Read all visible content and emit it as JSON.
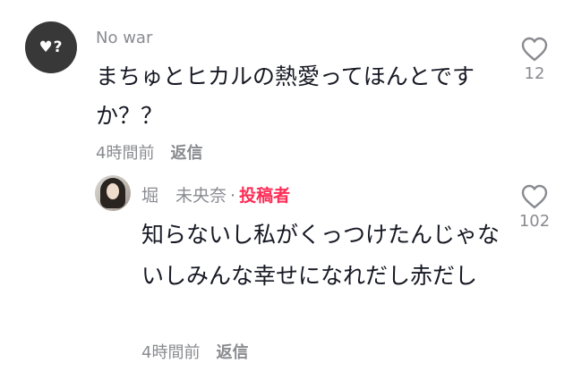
{
  "comment": {
    "username": "No war",
    "avatar_text": "♥?",
    "text": "まちゅとヒカルの熱愛ってほんとですか？？",
    "time": "4時間前",
    "reply_label": "返信",
    "like_count": "12",
    "like_icon": "heart-outline-icon"
  },
  "reply": {
    "username": "堀　未央奈",
    "separator": "·",
    "author_tag": "投稿者",
    "text": "知らないし私がくっつけたんじゃないしみんな幸せになれだし赤だし",
    "time": "4時間前",
    "reply_label": "返信",
    "like_count": "102",
    "like_icon": "heart-outline-icon"
  },
  "colors": {
    "text_primary": "#161823",
    "text_secondary": "#8a8b91",
    "author_accent": "#fe2c55"
  }
}
